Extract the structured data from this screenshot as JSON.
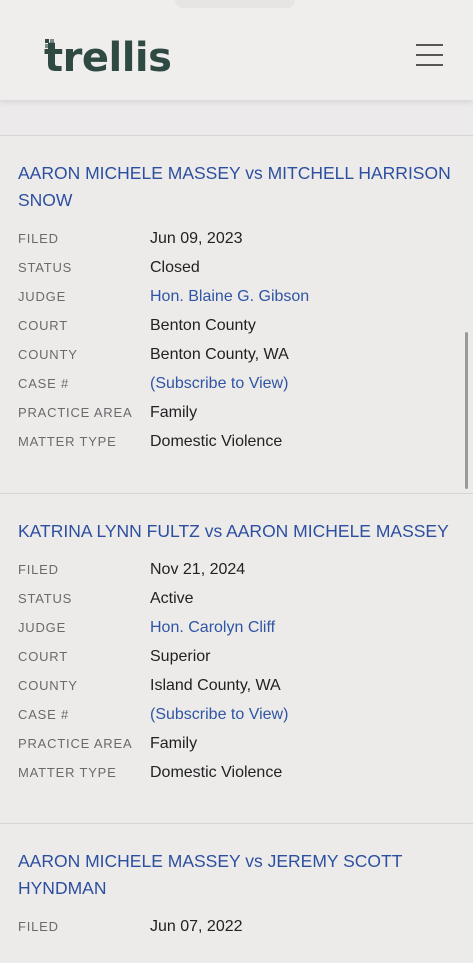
{
  "header": {
    "logo": "trellis",
    "menu_icon": "hamburger-menu-icon"
  },
  "cases": [
    {
      "title": "AARON MICHELE MASSEY vs MITCHELL HARRISON SNOW",
      "fields": [
        {
          "label": "FILED",
          "value": "Jun 09, 2023",
          "link": false
        },
        {
          "label": "STATUS",
          "value": "Closed",
          "link": false
        },
        {
          "label": "JUDGE",
          "value": "Hon. Blaine G. Gibson",
          "link": true
        },
        {
          "label": "COURT",
          "value": "Benton County",
          "link": false
        },
        {
          "label": "COUNTY",
          "value": "Benton County, WA",
          "link": false
        },
        {
          "label": "CASE #",
          "value": "(Subscribe to View)",
          "link": true
        },
        {
          "label": "PRACTICE AREA",
          "value": "Family",
          "link": false
        },
        {
          "label": "MATTER TYPE",
          "value": "Domestic Violence",
          "link": false
        }
      ]
    },
    {
      "title": "KATRINA LYNN FULTZ vs AARON MICHELE MASSEY",
      "fields": [
        {
          "label": "FILED",
          "value": "Nov 21, 2024",
          "link": false
        },
        {
          "label": "STATUS",
          "value": "Active",
          "link": false
        },
        {
          "label": "JUDGE",
          "value": "Hon. Carolyn Cliff",
          "link": true
        },
        {
          "label": "COURT",
          "value": "Superior",
          "link": false
        },
        {
          "label": "COUNTY",
          "value": "Island County, WA",
          "link": false
        },
        {
          "label": "CASE #",
          "value": "(Subscribe to View)",
          "link": true
        },
        {
          "label": "PRACTICE AREA",
          "value": "Family",
          "link": false
        },
        {
          "label": "MATTER TYPE",
          "value": "Domestic Violence",
          "link": false
        }
      ]
    },
    {
      "title": "AARON MICHELE MASSEY vs JEREMY SCOTT HYNDMAN",
      "fields": [
        {
          "label": "FILED",
          "value": "Jun 07, 2022",
          "link": false
        }
      ]
    }
  ],
  "colors": {
    "link": "#2f55a4",
    "title": "#2d4fa0",
    "logo": "#2f4a43",
    "background": "#eceaea"
  }
}
